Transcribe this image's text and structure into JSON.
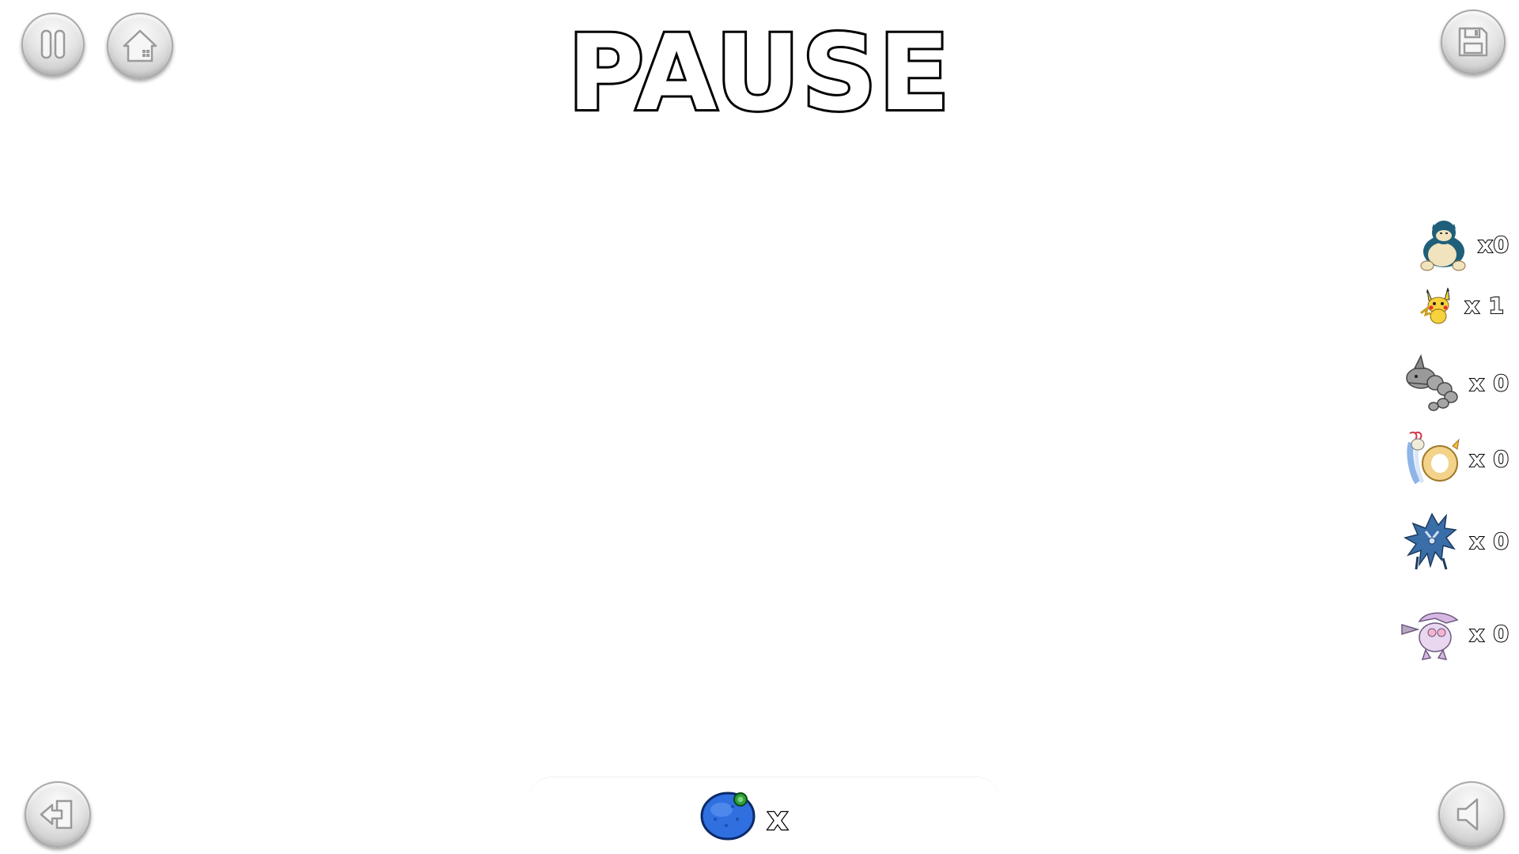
{
  "title": "PAUSE",
  "buttons": {
    "pause": "pause",
    "home": "home",
    "save": "save",
    "exit": "exit",
    "sound": "sound"
  },
  "roster": [
    {
      "name": "snorlax-sprite",
      "count": "x0"
    },
    {
      "name": "pikachu-sprite",
      "count": "x 1"
    },
    {
      "name": "onix-sprite",
      "count": "x 0"
    },
    {
      "name": "milotic-sprite",
      "count": "x 0"
    },
    {
      "name": "dialga-sprite",
      "count": "x 0"
    },
    {
      "name": "palkia-sprite",
      "count": "x 0"
    }
  ],
  "inventory": {
    "berry_icon": "blue-berry-icon",
    "berry_count": "x"
  },
  "colors": {
    "background": "#ffffff",
    "button_face": "#e6e6e6",
    "button_icon": "#9a9a9a",
    "text_outline": "#000000"
  }
}
